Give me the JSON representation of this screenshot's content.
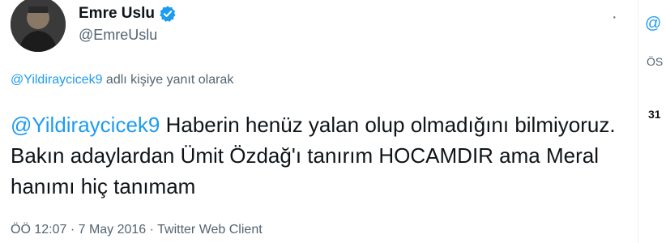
{
  "author": {
    "display_name": "Emre Uslu",
    "handle": "@EmreUslu",
    "verified": true
  },
  "reply": {
    "mention": "@Yildiraycicek9",
    "suffix": " adlı kişiye yanıt olarak"
  },
  "tweet": {
    "mention": "@Yildiraycicek9",
    "text": " Haberin henüz yalan olup olmadığını bilmiyoruz. Bakın adaylardan Ümit Özdağ'ı tanırım HOCAMDIR ama Meral hanımı hiç tanımam"
  },
  "meta": "ÖÖ 12:07 · 7 May 2016 · Twitter Web Client",
  "side_panel": {
    "at_text": "@",
    "os_text": "ÖS",
    "number_text": "31"
  },
  "colors": {
    "link": "#1d9bf0",
    "secondary": "#536471",
    "primary": "#0f1419"
  }
}
